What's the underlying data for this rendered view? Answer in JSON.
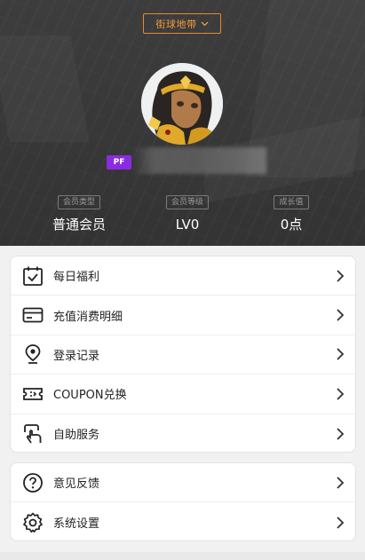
{
  "header": {
    "server_label": "街球地带",
    "badge": "PF",
    "stats": [
      {
        "label": "会员类型",
        "value": "普通会员"
      },
      {
        "label": "会员等级",
        "value": "LV0"
      },
      {
        "label": "成长值",
        "value": "0点"
      }
    ]
  },
  "menu_group_1": [
    {
      "label": "每日福利",
      "icon": "calendar-check-icon"
    },
    {
      "label": "充值消费明细",
      "icon": "card-icon"
    },
    {
      "label": "登录记录",
      "icon": "location-pin-icon"
    },
    {
      "label": "COUPON兑换",
      "icon": "ticket-icon"
    },
    {
      "label": "自助服务",
      "icon": "hand-touch-icon"
    }
  ],
  "menu_group_2": [
    {
      "label": "意见反馈",
      "icon": "question-icon"
    },
    {
      "label": "系统设置",
      "icon": "gear-icon"
    }
  ],
  "colors": {
    "accent": "#e8892b",
    "badge": "#8a2be2",
    "header_bg": "#3a3a3a"
  }
}
